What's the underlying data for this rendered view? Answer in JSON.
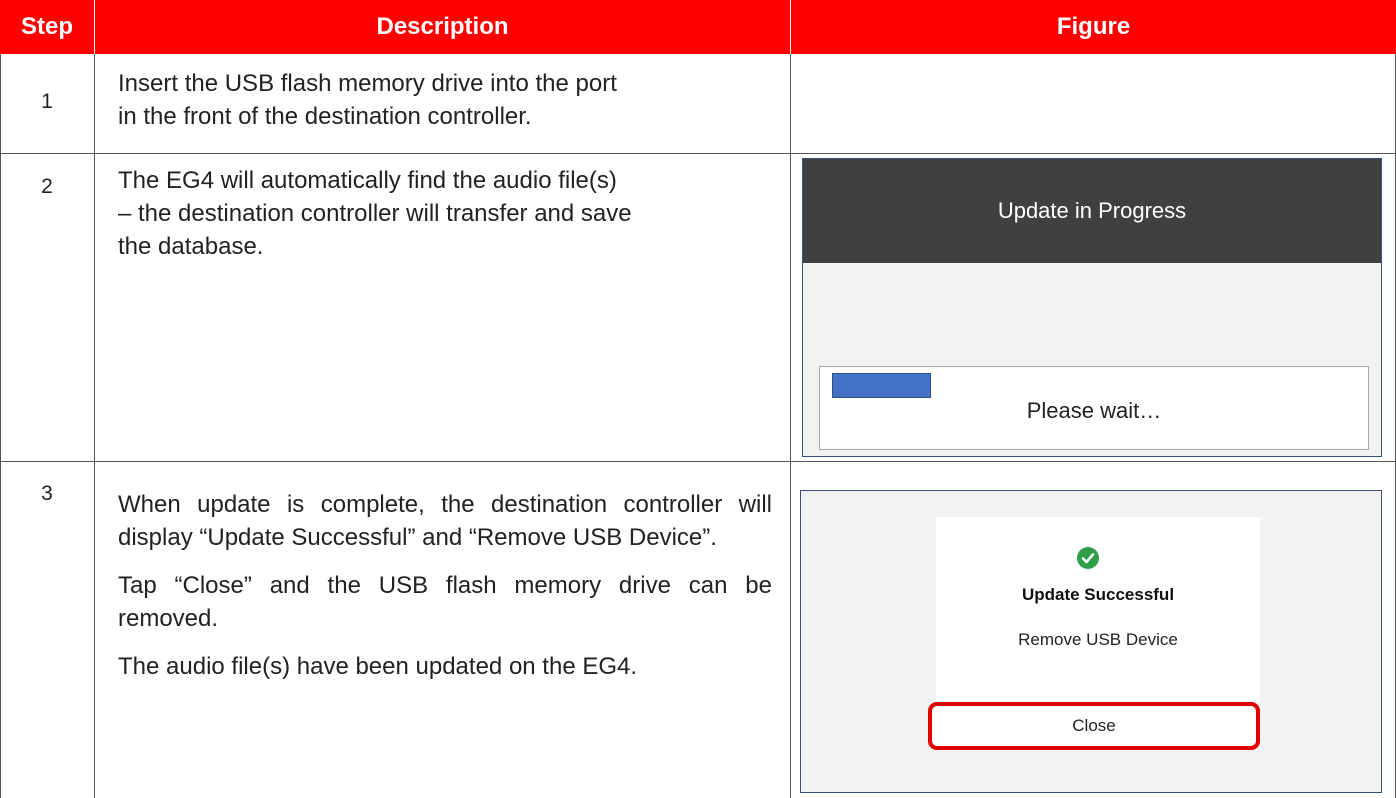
{
  "header": {
    "step": "Step",
    "description": "Description",
    "figure": "Figure"
  },
  "rows": [
    {
      "step": "1",
      "description": [
        "Insert the USB flash memory drive into the port",
        "in the front of the destination controller."
      ]
    },
    {
      "step": "2",
      "description": [
        "The EG4 will automatically find the audio file(s)",
        "– the destination controller will transfer and save",
        "the database."
      ],
      "figure": {
        "title": "Update in Progress",
        "progress": 0.18,
        "status": "Please wait…"
      }
    },
    {
      "step": "3",
      "paragraphs": [
        "When update is complete, the destination controller will display “Update Successful” and “Remove USB Device”.",
        "Tap “Close” and the USB flash memory drive can be removed.",
        "The audio file(s) have been updated on the EG4."
      ],
      "figure": {
        "icon": "check-circle-icon",
        "title": "Update Successful",
        "message": "Remove USB Device",
        "button": "Close"
      }
    }
  ],
  "colors": {
    "header_bg": "#ff0000",
    "dialog_bar": "#404040",
    "progress_fill": "#4472c4",
    "success": "#2e9e48",
    "highlight": "#e00000"
  }
}
